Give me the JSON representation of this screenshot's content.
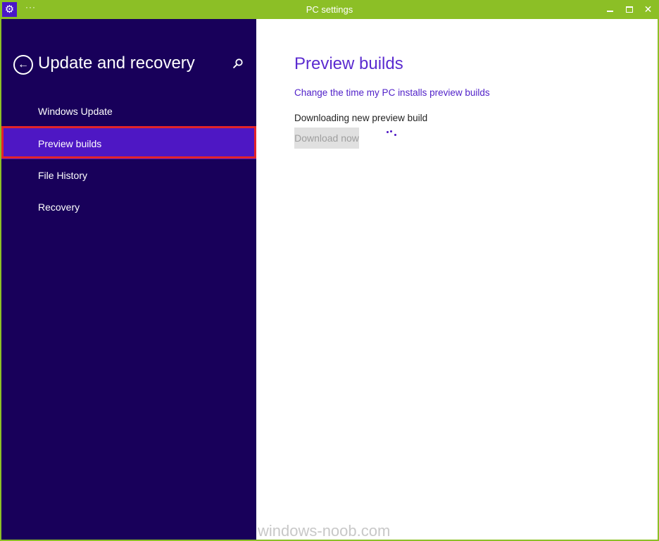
{
  "window": {
    "title": "PC settings",
    "app_menu_label": "···",
    "controls": {
      "minimize": "minimize",
      "maximize": "maximize",
      "close": "✕"
    }
  },
  "sidebar": {
    "title": "Update and recovery",
    "back_icon": "back-arrow-icon",
    "search_icon": "search-icon",
    "items": [
      {
        "label": "Windows Update",
        "selected": false
      },
      {
        "label": "Preview builds",
        "selected": true
      },
      {
        "label": "File History",
        "selected": false
      },
      {
        "label": "Recovery",
        "selected": false
      }
    ]
  },
  "main": {
    "title": "Preview builds",
    "link_label": "Change the time my PC installs preview builds",
    "status": "Downloading new preview build",
    "download_button_label": "Download now",
    "download_button_disabled": true
  },
  "watermark": "windows-noob.com",
  "colors": {
    "titlebar": "#8cbf26",
    "sidebar_bg": "#18005a",
    "selected_item": "#4e17c4",
    "highlight_border": "#e3242b",
    "accent": "#5b2bd0"
  }
}
